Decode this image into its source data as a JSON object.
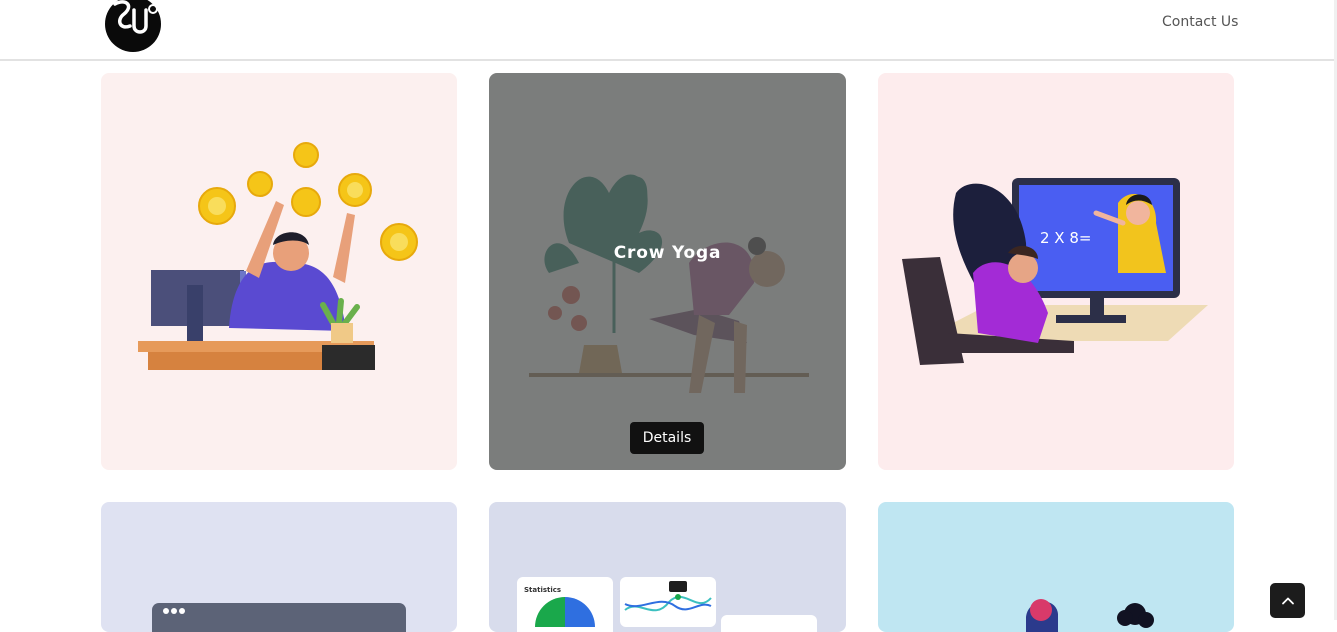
{
  "header": {
    "logo_text": "SU",
    "nav_contact": "Contact Us"
  },
  "cards": [
    {
      "hover_title": "",
      "button_label": ""
    },
    {
      "hover_title": "Crow Yoga",
      "button_label": "Details"
    },
    {
      "hover_title": "",
      "button_label": ""
    },
    {
      "hover_title": "",
      "button_label": ""
    },
    {
      "hover_title": "",
      "button_label": ""
    },
    {
      "hover_title": "",
      "button_label": ""
    }
  ],
  "illustrations": {
    "math_board_text": "2 X 8=",
    "stats_panel_label": "Statistics"
  },
  "scroll_top_icon": "chevron-up-icon",
  "colors": {
    "accent_dark": "#111111",
    "overlay": "#585e5d"
  }
}
